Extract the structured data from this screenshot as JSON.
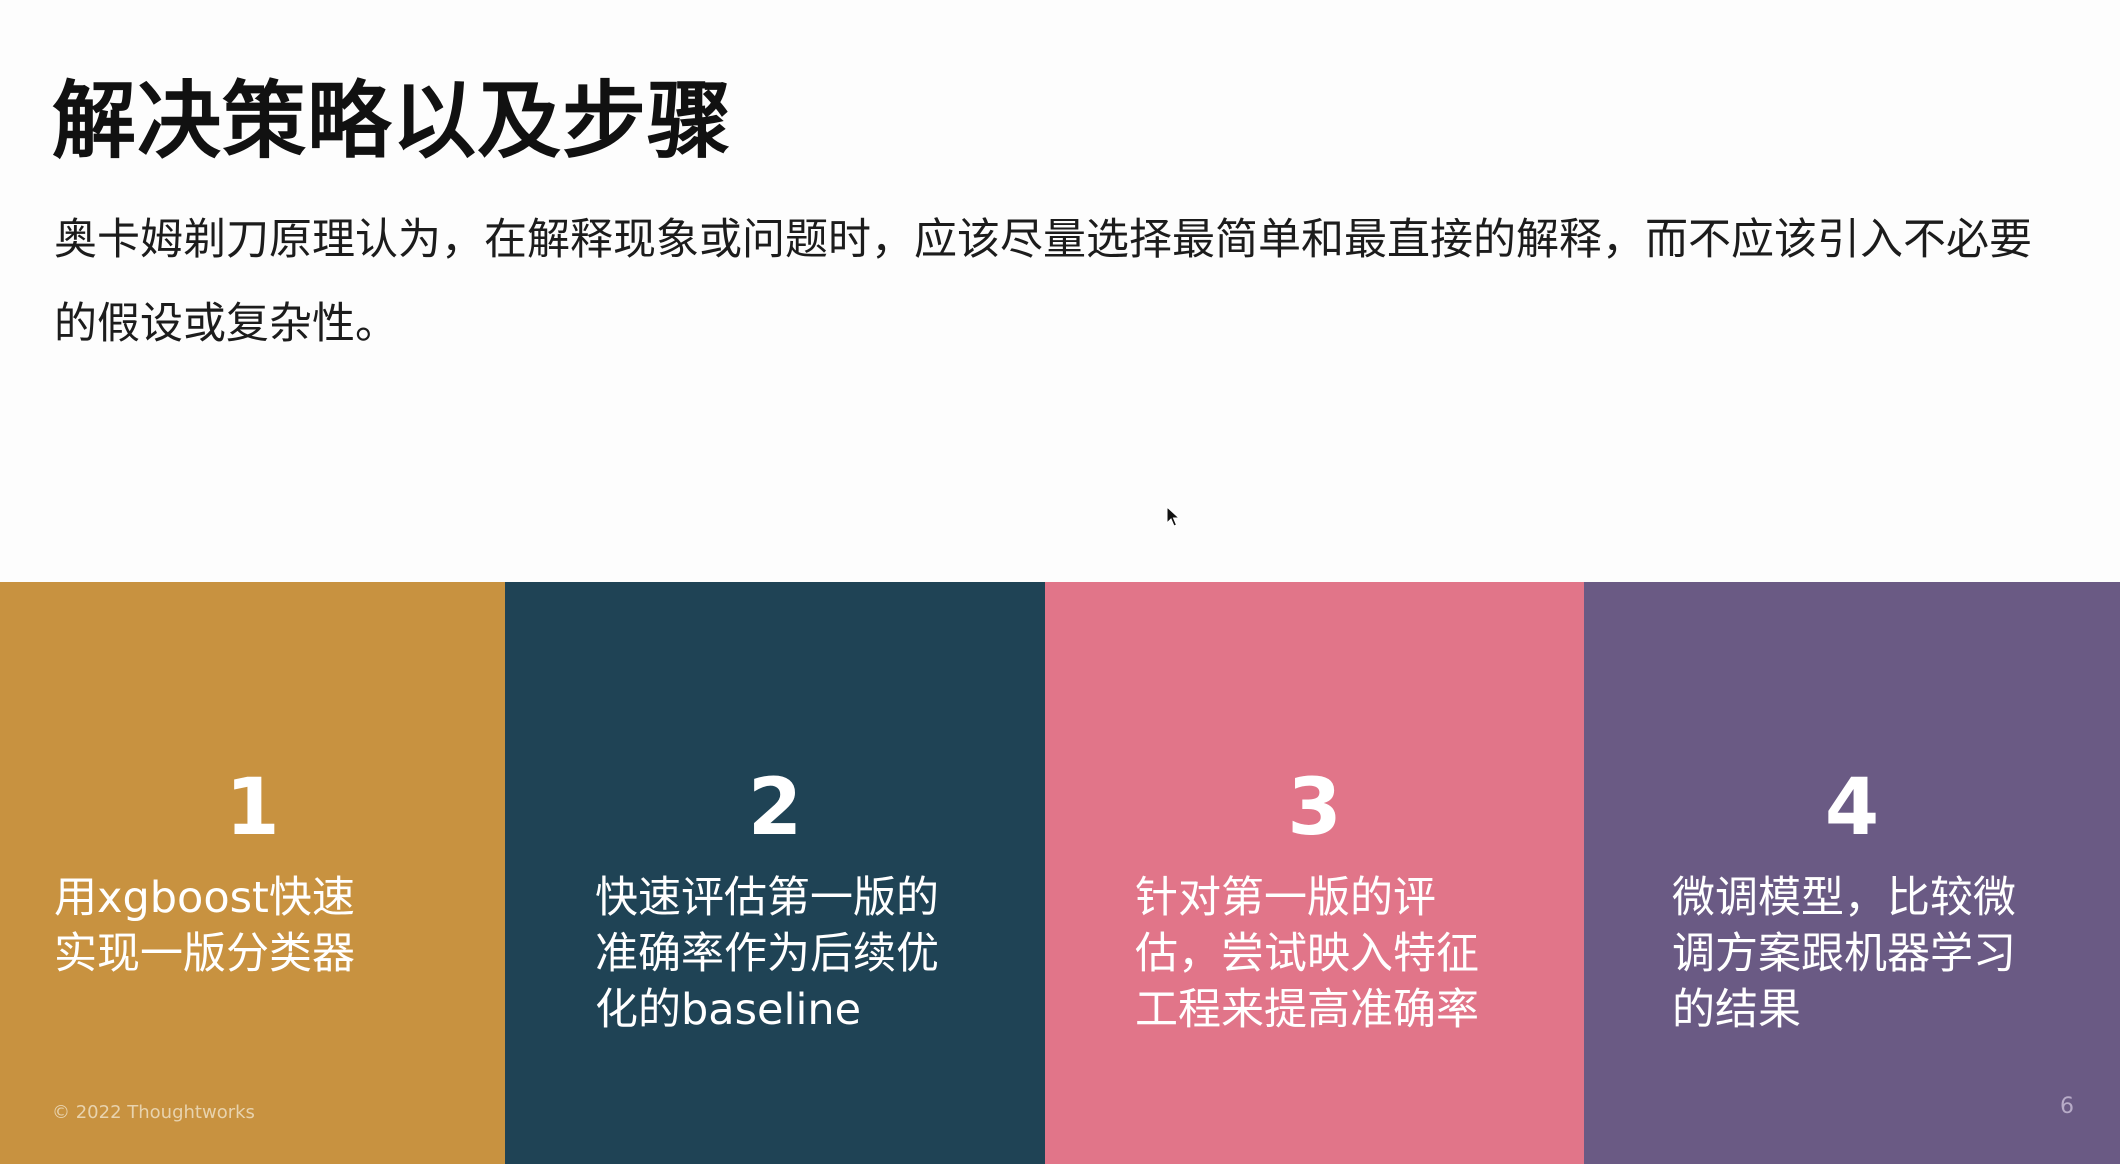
{
  "slide": {
    "title": "解决策略以及步骤",
    "intro": "奥卡姆剃刀原理认为，在解释现象或问题时，应该尽量选择最简单和最直接的解释，而不应该引入不必要的假设或复杂性。",
    "footer": {
      "copyright": "© 2022 Thoughtworks",
      "page_number": "6"
    }
  },
  "steps": [
    {
      "number": "1",
      "text": "用xgboost快速实现一版分类器",
      "color": "#c89240"
    },
    {
      "number": "2",
      "text": "快速评估第一版的准确率作为后续优化的baseline",
      "color": "#1f4355"
    },
    {
      "number": "3",
      "text": "针对第一版的评估，尝试映入特征工程来提高准确率",
      "color": "#e17589"
    },
    {
      "number": "4",
      "text": "微调模型，比较微调方案跟机器学习的结果",
      "color": "#6a5a84"
    }
  ],
  "icons": {
    "cursor": "mouse-pointer-icon"
  }
}
